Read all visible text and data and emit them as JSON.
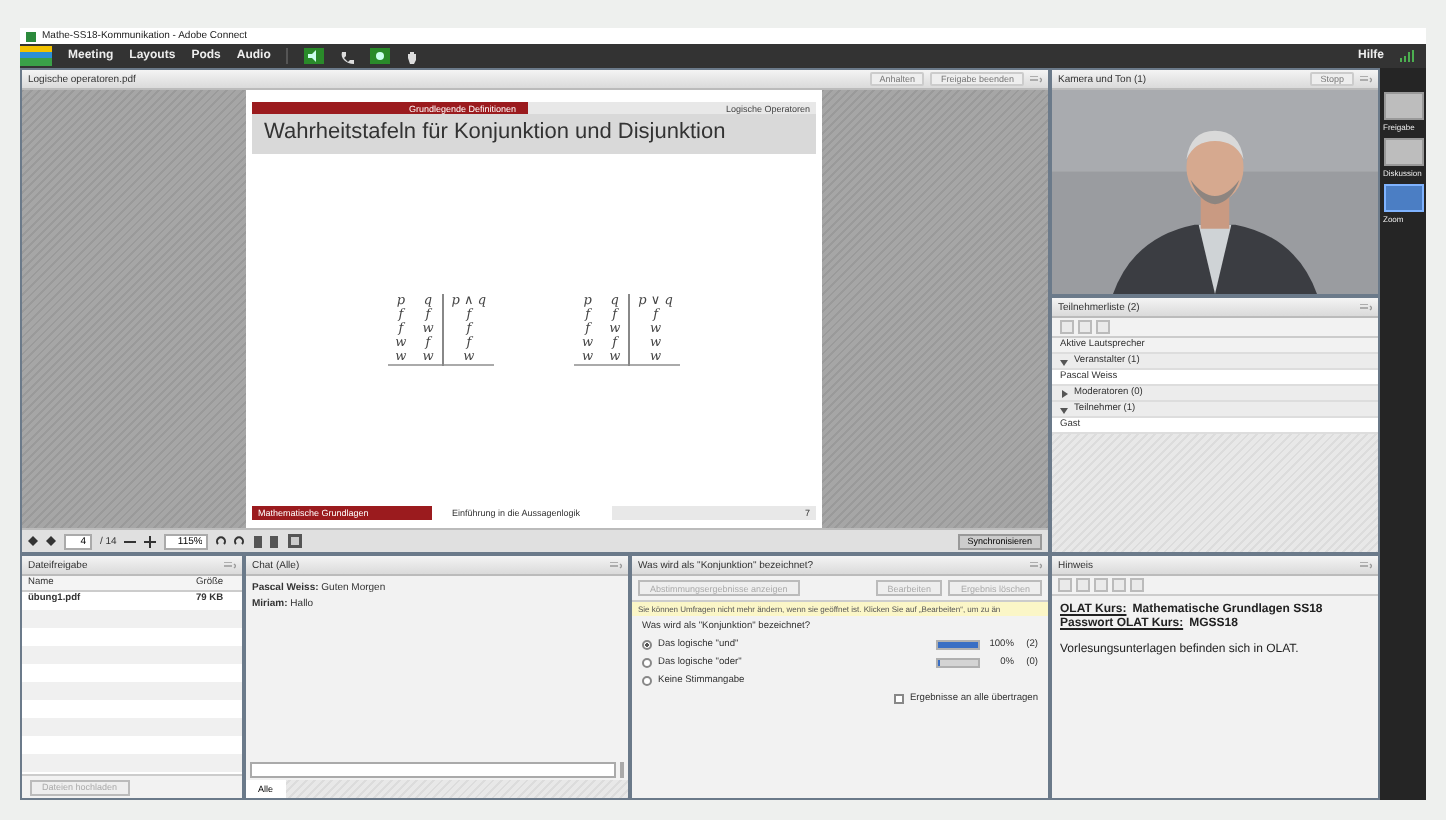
{
  "window": {
    "title": "Mathe-SS18-Kommunikation - Adobe Connect"
  },
  "menu": [
    "Meeting",
    "Layouts",
    "Pods",
    "Audio"
  ],
  "help": "Hilfe",
  "share_pod": {
    "title": "Logische operatoren.pdf",
    "buttons": [
      "Anhalten",
      "Freigabe beenden"
    ],
    "slide": {
      "section": "Grundlegende Definitionen",
      "topic": "Logische Operatoren",
      "heading": "Wahrheitstafeln für Konjunktion und Disjunktion",
      "tables": [
        {
          "header": [
            "p",
            "q",
            "p ∧ q"
          ],
          "rows": [
            [
              "f",
              "f",
              "f"
            ],
            [
              "f",
              "w",
              "f"
            ],
            [
              "w",
              "f",
              "f"
            ],
            [
              "w",
              "w",
              "w"
            ]
          ]
        },
        {
          "header": [
            "p",
            "q",
            "p ∨ q"
          ],
          "rows": [
            [
              "f",
              "f",
              "f"
            ],
            [
              "f",
              "w",
              "w"
            ],
            [
              "w",
              "f",
              "w"
            ],
            [
              "w",
              "w",
              "w"
            ]
          ]
        }
      ],
      "footer": [
        "Mathematische Grundlagen",
        "Einführung in die Aussagenlogik",
        "7"
      ]
    },
    "toolbar": {
      "page": "4",
      "pages": "/ 14",
      "zoom": "115%",
      "sync": "Synchronisieren"
    }
  },
  "camera_pod": {
    "title": "Kamera und Ton (1)",
    "stop": "Stopp"
  },
  "attendees": {
    "title": "Teilnehmerliste (2)",
    "active": "Aktive Lautsprecher",
    "groups": [
      {
        "label": "Veranstalter (1)",
        "expanded": true,
        "people": [
          "Pascal Weiss"
        ]
      },
      {
        "label": "Moderatoren (0)",
        "expanded": false
      },
      {
        "label": "Teilnehmer (1)",
        "expanded": true,
        "people": [
          "Gast"
        ]
      }
    ]
  },
  "files": {
    "title": "Dateifreigabe",
    "columns": [
      "Name",
      "Größe"
    ],
    "rows": [
      [
        "übung1.pdf",
        "79 KB"
      ]
    ],
    "upload": "Dateien hochladen"
  },
  "chat": {
    "title": "Chat (Alle)",
    "messages": [
      {
        "author": "Pascal Weiss:",
        "text": "Guten Morgen"
      },
      {
        "author": "Miriam:",
        "text": "Hallo"
      }
    ],
    "tab": "Alle"
  },
  "poll": {
    "title": "Was wird als \"Konjunktion\" bezeichnet?",
    "buttons": [
      "Abstimmungsergebnisse anzeigen",
      "Bearbeiten",
      "Ergebnis löschen"
    ],
    "notice": "Sie können Umfragen nicht mehr ändern, wenn sie geöffnet ist. Klicken Sie auf „Bearbeiten“, um zu än",
    "question": "Was wird als \"Konjunktion\" bezeichnet?",
    "options": [
      {
        "label": "Das logische \"und\"",
        "selected": true,
        "level": 1,
        "percent": "100%",
        "count": "(2)"
      },
      {
        "label": "Das logische \"oder\"",
        "selected": false,
        "level": 0,
        "percent": "0%",
        "count": "(0)"
      },
      {
        "label": "Keine Stimmangabe",
        "selected": false
      }
    ],
    "broadcast": {
      "label": "Ergebnisse an alle übertragen",
      "checked": false
    }
  },
  "notes": {
    "title": "Hinweis",
    "lines": [
      {
        "label": "OLAT Kurs:",
        "value": "Mathematische Grundlagen SS18"
      },
      {
        "label": "Passwort OLAT Kurs:",
        "value": "MGSS18"
      }
    ],
    "text": "Vorlesungsunterlagen befinden sich in OLAT."
  },
  "layouts": [
    {
      "label": "Freigabe",
      "selected": false
    },
    {
      "label": "Diskussion",
      "selected": false
    },
    {
      "label": "Zoom",
      "selected": true
    }
  ]
}
